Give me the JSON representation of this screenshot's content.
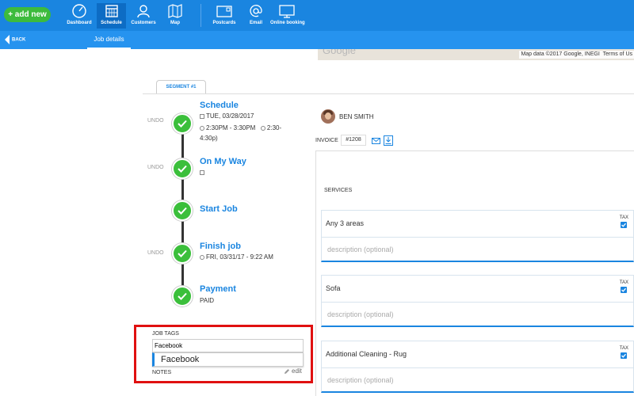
{
  "colors": {
    "nav_bg": "#1a85e0",
    "subbar_bg": "#2693ef",
    "accent": "#1a85e0",
    "success": "#3bbf3b",
    "add_button": "#3dbb3d",
    "highlight": "#e01010"
  },
  "topbar": {
    "add_new": "+ add new",
    "nav": [
      {
        "label": "Dashboard",
        "icon": "speedometer-icon"
      },
      {
        "label": "Schedule",
        "icon": "calendar-icon",
        "active": true
      },
      {
        "label": "Customers",
        "icon": "person-icon"
      },
      {
        "label": "Map",
        "icon": "map-icon"
      },
      {
        "label": "Postcards",
        "icon": "postcard-icon"
      },
      {
        "label": "Email",
        "icon": "at-icon"
      },
      {
        "label": "Online booking",
        "icon": "monitor-icon"
      }
    ]
  },
  "subbar": {
    "back": "BACK",
    "title": "Job details"
  },
  "map": {
    "logo": "Google",
    "attribution": "Map data ©2017 Google, INEGI",
    "terms": "Terms of Us"
  },
  "segment": {
    "tab_label": "SEGMENT #1"
  },
  "steps": [
    {
      "title": "Schedule",
      "undo": "UNDO",
      "date": "TUE, 03/28/2017",
      "time": "2:30PM - 3:30PM",
      "arrival_window": "2:30-",
      "arrival_window_cont": "4:30p)"
    },
    {
      "title": "On My Way",
      "undo": "UNDO"
    },
    {
      "title": "Start Job"
    },
    {
      "title": "Finish job",
      "undo": "UNDO",
      "date": "FRI, 03/31/17 - 9:22 AM"
    },
    {
      "title": "Payment",
      "status": "PAID"
    }
  ],
  "technician": {
    "name": "BEN SMITH"
  },
  "invoice": {
    "label": "INVOICE",
    "number": "#1208"
  },
  "services": {
    "label": "SERVICES",
    "items": [
      {
        "name": "Any 3 areas",
        "description_placeholder": "description (optional)",
        "tax_label": "TAX",
        "tax": true
      },
      {
        "name": "Sofa",
        "description_placeholder": "description (optional)",
        "tax_label": "TAX",
        "tax": true
      },
      {
        "name": "Additional Cleaning - Rug",
        "description_placeholder": "description (optional)",
        "tax_label": "TAX",
        "tax": true
      }
    ]
  },
  "job_tags": {
    "label": "JOB TAGS",
    "input_value": "Facebook",
    "suggestion": "Facebook"
  },
  "notes": {
    "label": "NOTES",
    "edit": "edit"
  }
}
